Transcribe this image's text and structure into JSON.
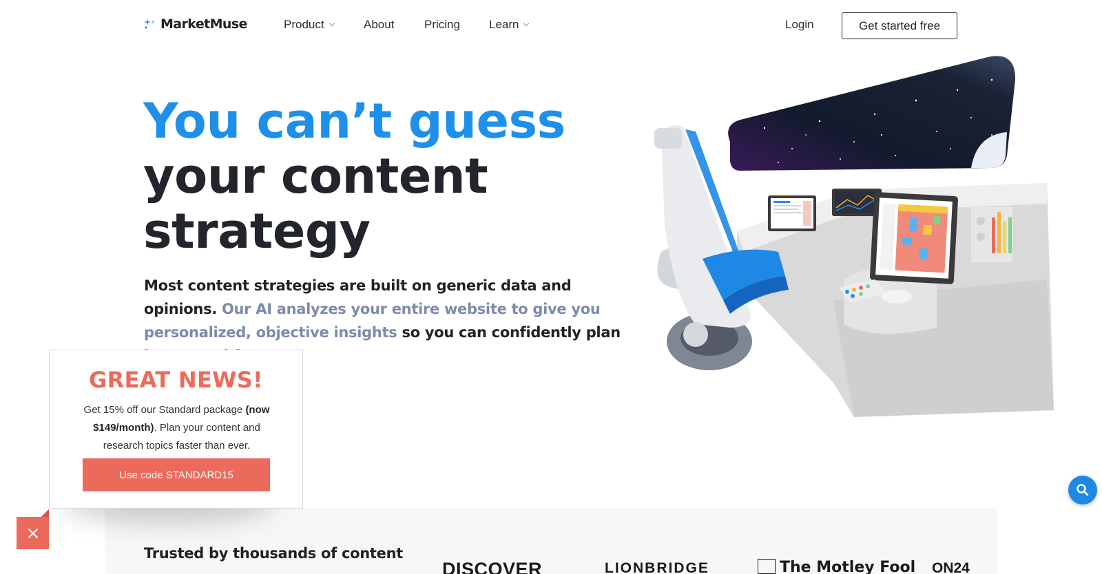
{
  "nav": {
    "logo_text": "MarketMuse",
    "items": [
      {
        "label": "Product",
        "has_dropdown": true
      },
      {
        "label": "About",
        "has_dropdown": false
      },
      {
        "label": "Pricing",
        "has_dropdown": false
      },
      {
        "label": "Learn",
        "has_dropdown": true
      }
    ],
    "login_label": "Login",
    "cta_label": "Get started free"
  },
  "hero": {
    "title_line1": "You can’t guess",
    "title_line2": "your content",
    "title_line3": "strategy",
    "sub_part1": "Most content strategies are built on generic data and opinions. ",
    "sub_part2": "Our AI analyzes your entire website to give you personalized, objective insights",
    "sub_part3": " so you can confidently plan better and faster."
  },
  "trusted": {
    "heading": "Trusted by thousands of content",
    "brands": [
      "DISCOVER",
      "LIONBRIDGE",
      "The Motley Fool",
      "ON24"
    ]
  },
  "promo": {
    "title": "GREAT NEWS!",
    "body_part1": "Get 15% off our Standard package ",
    "body_bold": "(now $149/month)",
    "body_part2": ". Plan your content and research topics faster than ever.",
    "button_label": "Use code STANDARD15"
  },
  "colors": {
    "accent_blue": "#1e90ea",
    "muted_blue": "#7b8bab",
    "promo_coral": "#ec6a5c",
    "dark_text": "#22252b"
  },
  "icons": {
    "logo": "sparkle-icon",
    "close": "close-icon",
    "search": "search-icon",
    "dropdown": "chevron-down-icon"
  }
}
